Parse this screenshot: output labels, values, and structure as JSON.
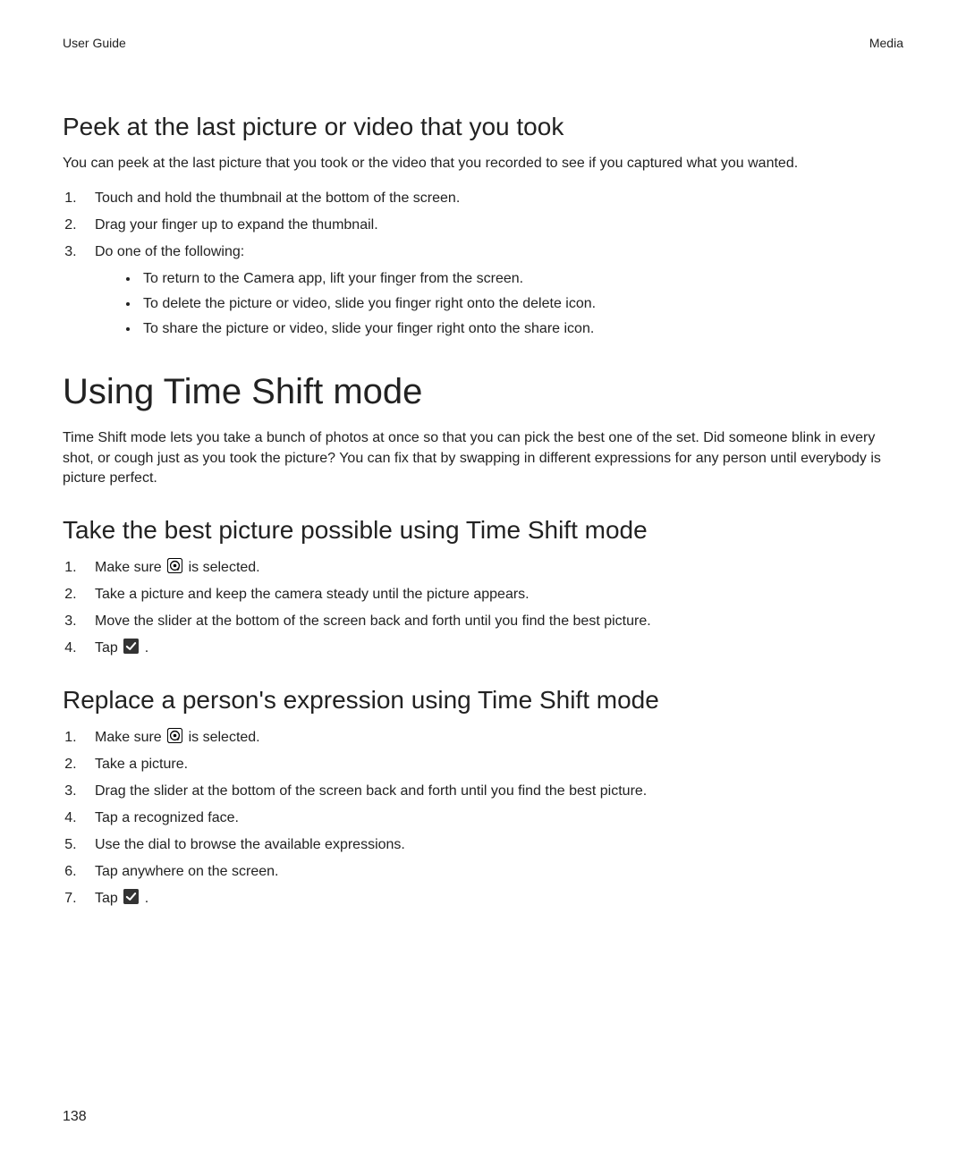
{
  "header": {
    "left": "User Guide",
    "right": "Media"
  },
  "section1": {
    "title": "Peek at the last picture or video that you took",
    "intro": "You can peek at the last picture that you took or the video that you recorded to see if you captured what you wanted.",
    "steps": {
      "s1": "Touch and hold the thumbnail at the bottom of the screen.",
      "s2": "Drag your finger up to expand the thumbnail.",
      "s3": "Do one of the following:",
      "s3a": "To return to the Camera app, lift your finger from the screen.",
      "s3b": "To delete the picture or video, slide you finger right onto the delete icon.",
      "s3c": "To share the picture or video, slide your finger right onto the share icon."
    }
  },
  "section2": {
    "title": "Using Time Shift mode",
    "intro": "Time Shift mode lets you take a bunch of photos at once so that you can pick the best one of the set. Did someone blink in every shot, or cough just as you took the picture? You can fix that by swapping in different expressions for any person until everybody is picture perfect."
  },
  "section3": {
    "title": "Take the best picture possible using Time Shift mode",
    "steps": {
      "s1_pre": "Make sure ",
      "s1_post": " is selected.",
      "s2": "Take a picture and keep the camera steady until the picture appears.",
      "s3": "Move the slider at the bottom of the screen back and forth until you find the best picture.",
      "s4_pre": "Tap ",
      "s4_post": " ."
    }
  },
  "section4": {
    "title": "Replace a person's expression using Time Shift mode",
    "steps": {
      "s1_pre": "Make sure ",
      "s1_post": " is selected.",
      "s2": "Take a picture.",
      "s3": "Drag the slider at the bottom of the screen back and forth until you find the best picture.",
      "s4": "Tap a recognized face.",
      "s5": "Use the dial to browse the available expressions.",
      "s6": "Tap anywhere on the screen.",
      "s7_pre": "Tap ",
      "s7_post": " ."
    }
  },
  "pageNumber": "138",
  "icons": {
    "timeshift": "time-shift-icon",
    "check": "checkmark-icon"
  }
}
